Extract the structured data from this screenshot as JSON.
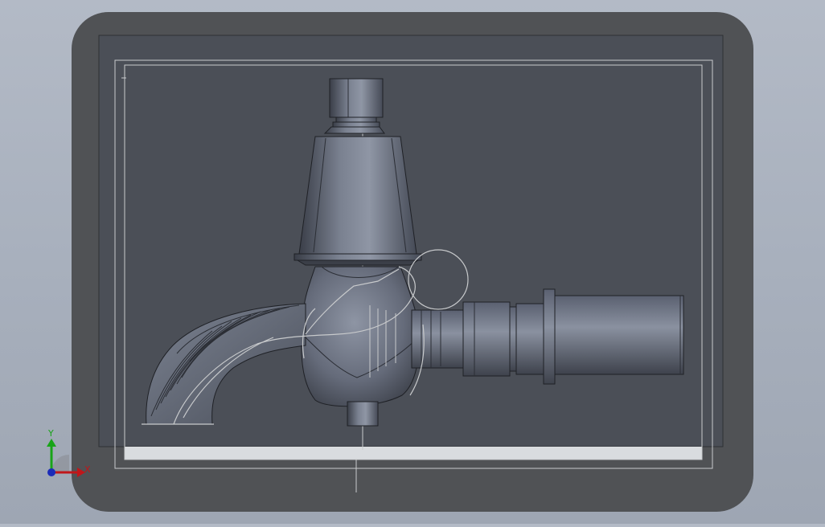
{
  "app": {
    "title": "",
    "view": "CAD 3D viewport"
  },
  "triad": {
    "x_label": "X",
    "y_label": "Y",
    "x_color": "#c0161a",
    "y_color": "#18a418",
    "z_color": "#1b2bb8"
  },
  "scene": {
    "background_color": "#a8b0bd",
    "frame_color": "#505255",
    "sheet_color": "#4b4f57",
    "model_color": "#6a7080",
    "sketch_line_color": "#c8cacc"
  }
}
